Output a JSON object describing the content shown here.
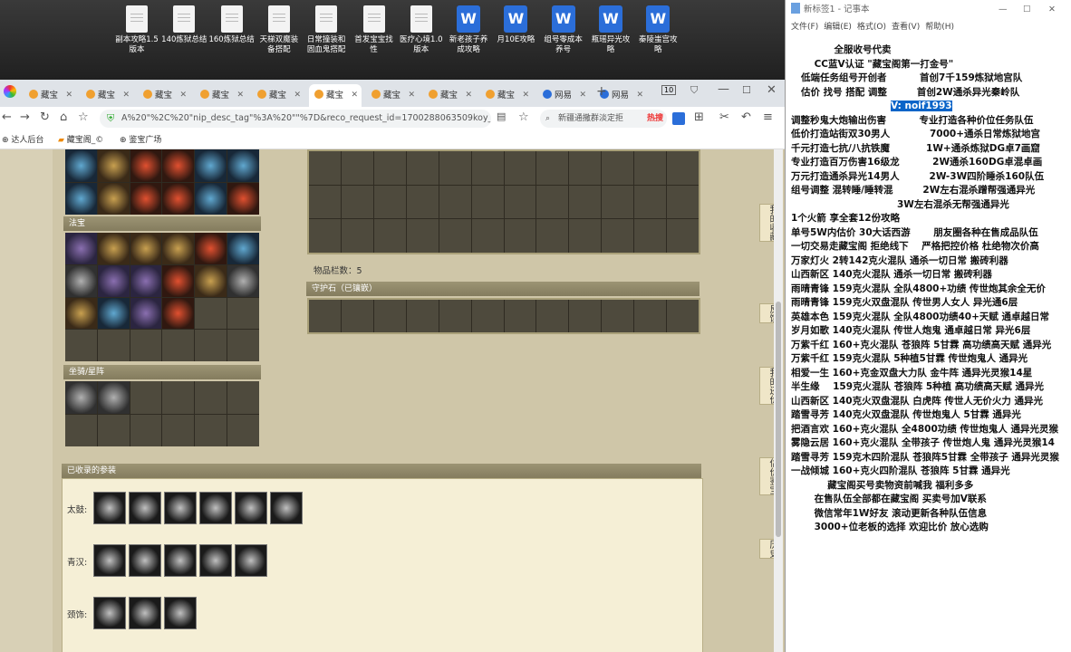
{
  "desktop": {
    "icons": [
      {
        "label": "副本攻略1.5\n版本",
        "kind": "doc"
      },
      {
        "label": "140炼狱总结",
        "kind": "doc"
      },
      {
        "label": "160炼狱总结",
        "kind": "doc"
      },
      {
        "label": "天梯双魔装\n备搭配",
        "kind": "doc"
      },
      {
        "label": "日常撞装和\n固血鬼搭配",
        "kind": "doc"
      },
      {
        "label": "首发宝宝找\n性",
        "kind": "doc"
      },
      {
        "label": "医疗心境1.0\n版本",
        "kind": "doc"
      },
      {
        "label": "新老孩子养\n成攻略",
        "kind": "wps"
      },
      {
        "label": "月10E攻略",
        "kind": "wps"
      },
      {
        "label": "组号零成本\n养号",
        "kind": "wps"
      },
      {
        "label": "瓶瑶异光攻\n略",
        "kind": "wps"
      },
      {
        "label": "秦陵蚩宫攻\n略",
        "kind": "wps"
      }
    ]
  },
  "browser": {
    "tabs": [
      "藏宝",
      "藏宝",
      "藏宝",
      "藏宝",
      "藏宝",
      "藏宝",
      "藏宝",
      "藏宝",
      "藏宝",
      "网易",
      "网易"
    ],
    "active_tab": 5,
    "tab_count": "10",
    "url": "A%20\"%2C%20\"nip_desc_tag\"%3A%20\"\"%7D&reco_request_id=1700288063509koy_Q",
    "search_text": "新疆通撒群淡定拒",
    "hot_label": "热搜",
    "bookmarks": [
      "达人后台",
      "藏宝阁_©",
      "鉴宝广场"
    ]
  },
  "page": {
    "fabao_title": "法宝",
    "mount_title": "坐骑/星阵",
    "items_count": "物品栏数：5",
    "guard_title": "守护石（已镶嵌）",
    "collection_title": "已收录的参装",
    "collection_rows": [
      {
        "label": "太鼓:",
        "count": 6
      },
      {
        "label": "青汉:",
        "count": 5
      },
      {
        "label": "颈饰:",
        "count": 3
      }
    ],
    "right_labels": [
      "我的收藏",
      "反馈",
      "我的还价",
      "估价鉴宝",
      "历史"
    ]
  },
  "notepad": {
    "title": "新标签1 - 记事本",
    "menu": [
      "文件(F)",
      "编辑(E)",
      "格式(O)",
      "查看(V)",
      "帮助(H)"
    ],
    "lines": [
      "             全服收号代卖",
      "       CC蓝V认证 \"藏宝阁第一打金号\"",
      "   低端任务组号开创者          首创7千159炼狱地宫队",
      "   估价 找号 搭配 调整         首创2W通杀异光秦岭队",
      "              V: noif1993",
      "",
      "调整秒鬼大炮输出伤害          专业打造各种价位任务队伍",
      "低价打造站街双30男人            7000+通杀日常炼狱地宫",
      "千元打造七抗/八抗铁魔           1W+通杀炼狱DG卓7画窟",
      "专业打造百万伤害16级龙          2W通杀160DG卓混卓画",
      "万元打造通杀异光14男人         2W-3W四阶睡杀160队伍",
      "组号调整 混转睡/睡转混         2W左右混杀蹭帮强通异光",
      "                                3W左右混杀无帮强通异光",
      "1个火箭 享全套12份攻略",
      "单号5W内估价 30大话西游       朋友圈各种在售成品队伍",
      "一切交易走藏宝阁 拒绝线下    严格把控价格 杜绝物次价高",
      "",
      "",
      "万家灯火 2转142克火混队 通杀一切日常 搬砖利器",
      "山西新区 140克火混队 通杀一切日常 搬砖利器",
      "雨晴青锋 159克火混队 全队4800+功绩 传世炮其余全无价",
      "雨晴青锋 159克火双盘混队 传世男人女人 异光通6层",
      "英雄本色 159克火混队 全队4800功绩40+天赋 通卓越日常",
      "岁月如歌 140克火混队 传世人炮鬼 通卓越日常 异光6层",
      "万紫千红 160+克火混队 苍狼阵 5甘霖 高功绩高天赋 通异光",
      "万紫千红 159克火混队 5种植5甘霖 传世炮鬼人 通异光",
      "相爱一生 160+克金双盘大力队 金牛阵 通异光灵猴14星",
      "半生缘    159克火混队 苍狼阵 5种植 高功绩高天赋 通异光",
      "山西新区 140克火双盘混队 白虎阵 传世人无价火力 通异光",
      "踏雪寻芳 140克火双盘混队 传世炮鬼人 5甘霖 通异光",
      "把酒言欢 160+克火混队 全4800功绩 传世炮鬼人 通异光灵猴",
      "雾隐云居 160+克火混队 全带孩子 传世炮人鬼 通异光灵猴14",
      "踏雪寻芳 159克木四阶混队 苍狼阵5甘霖 全带孩子 通异光灵猴",
      "一战倾城 160+克火四阶混队 苍狼阵 5甘霖 通异光",
      "",
      "           藏宝阁买号卖物资前喊我 福利多多",
      "       在售队伍全部都在藏宝阁 买卖号加V联系",
      "       微信常年1W好友 滚动更新各种队伍信息",
      "       3000+位老板的选择 欢迎比价 放心选购"
    ],
    "highlight_line": 4
  },
  "colors": {
    "page_bg": "#cfc6a8",
    "panel_header": "#8c8466",
    "highlight": "#0a64c8"
  }
}
